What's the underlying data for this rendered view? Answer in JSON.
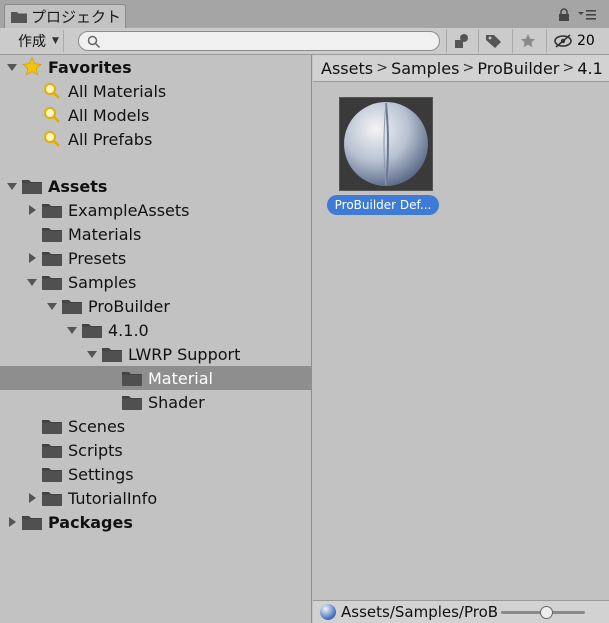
{
  "window": {
    "tab_label": "プロジェクト"
  },
  "toolbar": {
    "create_label": "作成",
    "search_placeholder": "",
    "hidden_count": "20"
  },
  "tree": {
    "favorites": {
      "label": "Favorites",
      "items": [
        "All Materials",
        "All Models",
        "All Prefabs"
      ]
    },
    "assets_label": "Assets",
    "rows": [
      {
        "label": "ExampleAssets",
        "depth": 1,
        "arrow": "right"
      },
      {
        "label": "Materials",
        "depth": 1,
        "arrow": "none"
      },
      {
        "label": "Presets",
        "depth": 1,
        "arrow": "right"
      },
      {
        "label": "Samples",
        "depth": 1,
        "arrow": "down"
      },
      {
        "label": "ProBuilder",
        "depth": 2,
        "arrow": "down"
      },
      {
        "label": "4.1.0",
        "depth": 3,
        "arrow": "down"
      },
      {
        "label": "LWRP Support",
        "depth": 4,
        "arrow": "down"
      },
      {
        "label": "Material",
        "depth": 5,
        "arrow": "none",
        "selected": true
      },
      {
        "label": "Shader",
        "depth": 5,
        "arrow": "none"
      },
      {
        "label": "Scenes",
        "depth": 1,
        "arrow": "none"
      },
      {
        "label": "Scripts",
        "depth": 1,
        "arrow": "none"
      },
      {
        "label": "Settings",
        "depth": 1,
        "arrow": "none"
      },
      {
        "label": "TutorialInfo",
        "depth": 1,
        "arrow": "right"
      }
    ],
    "packages_label": "Packages"
  },
  "breadcrumb": [
    "Assets",
    "Samples",
    "ProBuilder",
    "4.1"
  ],
  "asset": {
    "label": "ProBuilder Def..."
  },
  "status": {
    "path": "Assets/Samples/ProB",
    "zoom": 0.55
  },
  "colors": {
    "selection_blue": "#3e7bd6",
    "tree_selected": "#8e8e8e",
    "favorites_star": "#f4c20d"
  }
}
